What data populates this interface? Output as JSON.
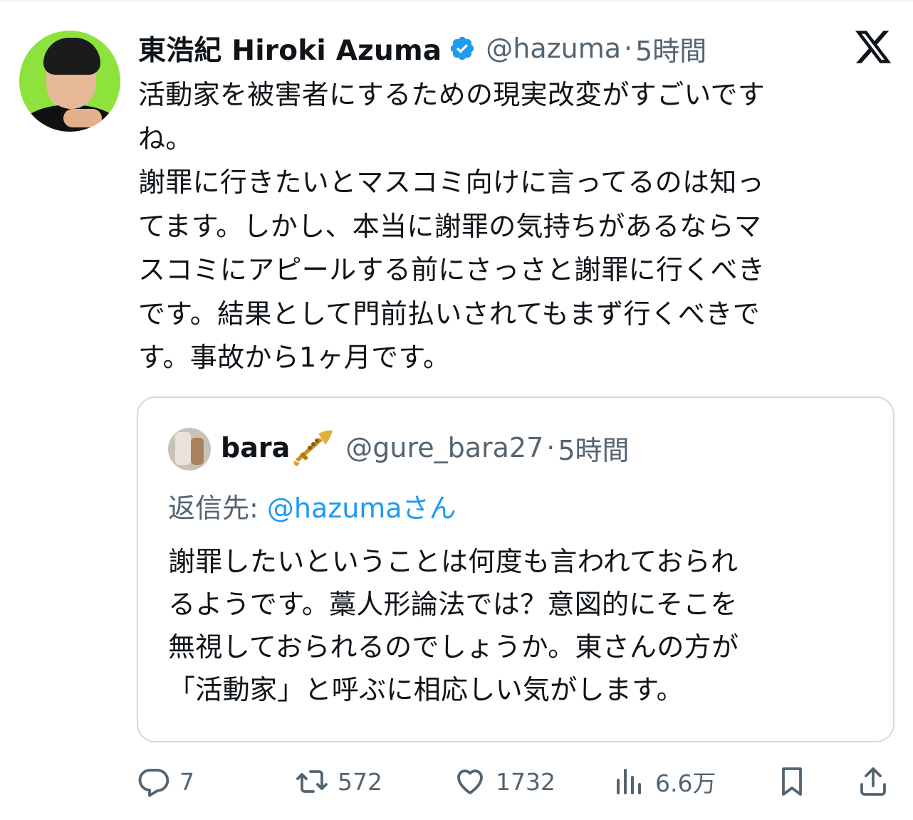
{
  "tweet": {
    "author": {
      "display_name": "東浩紀 Hiroki Azuma",
      "handle": "@hazuma",
      "separator": "·",
      "time": "5時間",
      "verified_color": "#1d9bf0"
    },
    "text_lines": [
      "活動家を被害者にするための現実改変がすごいです",
      "ね。",
      "謝罪に行きたいとマスコミ向けに言ってるのは知っ",
      "てます。しかし、本当に謝罪の気持ちがあるならマ",
      "スコミにアピールする前にさっさと謝罪に行くべき",
      "です。結果として門前払いされてもまず行くべきで",
      "す。事故から1ヶ月です。"
    ],
    "quote": {
      "display_name": "bara",
      "emoji_icon": "trumpet-icon",
      "handle": "@gure_bara27",
      "separator": "·",
      "time": "5時間",
      "reply_prefix": "返信先: ",
      "reply_mention": "@hazumaさん",
      "text_lines": [
        "謝罪したいということは何度も言われておられ",
        "るようです。藁人形論法では？意図的にそこを",
        "無視しておられるのでしょうか。東さんの方が",
        "「活動家」と呼ぶに相応しい気がします。"
      ]
    },
    "actions": {
      "reply_count": "7",
      "retweet_count": "572",
      "like_count": "1732",
      "view_count": "6.6万"
    },
    "colors": {
      "text": "#0f1419",
      "secondary": "#536471",
      "link": "#1d9bf0",
      "border": "#cfd9de"
    }
  }
}
